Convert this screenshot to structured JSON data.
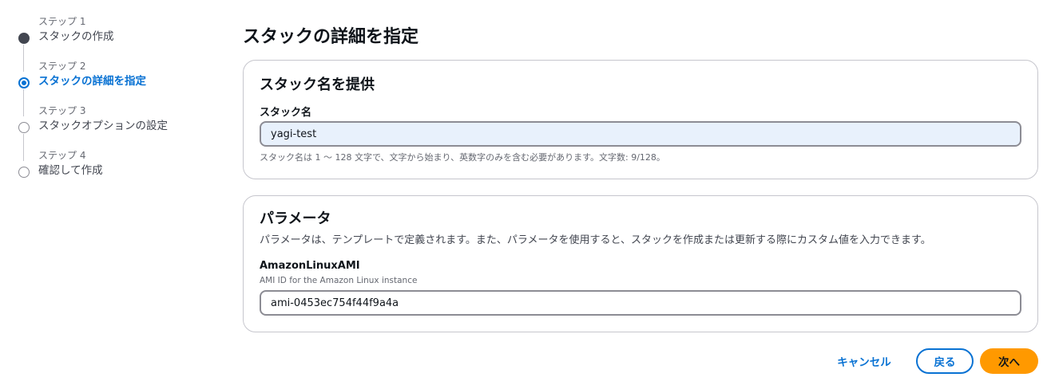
{
  "stepper": {
    "steps": [
      {
        "number": "ステップ 1",
        "title": "スタックの作成",
        "state": "done"
      },
      {
        "number": "ステップ 2",
        "title": "スタックの詳細を指定",
        "state": "current"
      },
      {
        "number": "ステップ 3",
        "title": "スタックオプションの設定",
        "state": "todo"
      },
      {
        "number": "ステップ 4",
        "title": "確認して作成",
        "state": "todo"
      }
    ]
  },
  "page": {
    "title": "スタックの詳細を指定"
  },
  "stack_name_section": {
    "title": "スタック名を提供",
    "label": "スタック名",
    "value": "yagi-test",
    "hint": "スタック名は 1 ～ 128 文字で、文字から始まり、英数字のみを含む必要があります。文字数: 9/128。"
  },
  "parameters_section": {
    "title": "パラメータ",
    "description": "パラメータは、テンプレートで定義されます。また、パラメータを使用すると、スタックを作成または更新する際にカスタム値を入力できます。",
    "parameter": {
      "name": "AmazonLinuxAMI",
      "description": "AMI ID for the Amazon Linux instance",
      "value": "ami-0453ec754f44f9a4a"
    }
  },
  "actions": {
    "cancel_label": "キャンセル",
    "back_label": "戻る",
    "next_label": "次へ"
  },
  "colors": {
    "accent": "#0972d3",
    "primary_button": "#ff9900",
    "input_highlight": "#e8f1fc"
  }
}
